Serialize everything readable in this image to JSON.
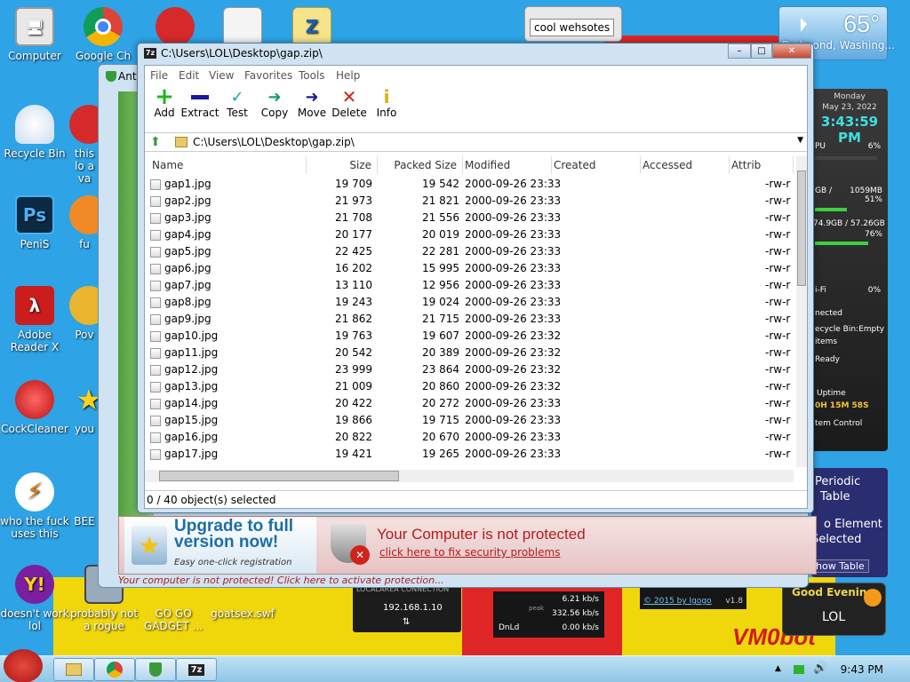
{
  "desktop": {
    "icons": [
      {
        "label": "Computer"
      },
      {
        "label": "Google Ch"
      },
      {
        "label": "Recycle Bin"
      },
      {
        "label": "this lo a va"
      },
      {
        "label": "PeniS"
      },
      {
        "label": "fu"
      },
      {
        "label": "Adobe Reader X"
      },
      {
        "label": "Pov"
      },
      {
        "label": "CockCleaner"
      },
      {
        "label": "you"
      },
      {
        "label": "who the fuck uses this"
      },
      {
        "label": "BEE"
      },
      {
        "label": "doesn't work lol"
      },
      {
        "label": "probably not a rogue"
      },
      {
        "label": "GO GO GADGET ..."
      },
      {
        "label": "goatsex.swf"
      }
    ],
    "icon_letters": {
      "photoshop": "Ps",
      "note": "Z"
    },
    "search_gadget_text": "cool wehsotes",
    "weather": {
      "temp": "65°",
      "location": "Redmond, Washing..."
    },
    "sysmon": {
      "day": "Monday",
      "date": "May 23, 2022",
      "time": "3:43:59 PM",
      "cpu_label": "PU",
      "cpu": "6%",
      "ram_left": "GB /",
      "ram_total": "1059MB",
      "ram_pct": "51%",
      "disk": "74.9GB / 57.26GB",
      "disk_pct": "76%",
      "wifi": "i-Fi",
      "wifi_pct": "0%",
      "net": "nected",
      "recycle": "ecycle Bin:Empty",
      "items": "items",
      "ready": "Ready",
      "uptime_label": "Uptime",
      "uptime": "0H 15M 58S",
      "control": "tem Control"
    },
    "periodic": {
      "title1": "Periodic",
      "title2": "Table",
      "line1": "o Element",
      "line2": "Selected",
      "button": "how Table"
    },
    "evening": {
      "greeting": "Good Evening.",
      "name": "LOL"
    },
    "net_gadget": {
      "ip": "192.168.1.10",
      "header": "LOCALAREA CONNECTION"
    },
    "speed_gadget": {
      "up": "6.21 kb/s",
      "peak": "332.56 kb/s",
      "dnld_label": "DnLd",
      "dnld": "0.00 kb/s",
      "peak_label": "peak"
    },
    "copyright": {
      "text": "© 2015 by Igogo",
      "version": "v1.8"
    },
    "wallpaper_text": "VM0bot"
  },
  "antivirus": {
    "title": "Ant",
    "promo_title": "Upgrade to full version now!",
    "promo_sub": "Easy one-click registration",
    "warning": "Your Computer is not protected",
    "warning_link": "click here to fix security problems",
    "bottom": "Your computer is not protected! Click here to activate protection..."
  },
  "zip": {
    "title": "C:\\Users\\LOL\\Desktop\\gap.zip\\",
    "menu": [
      "File",
      "Edit",
      "View",
      "Favorites",
      "Tools",
      "Help"
    ],
    "toolbar": [
      "Add",
      "Extract",
      "Test",
      "Copy",
      "Move",
      "Delete",
      "Info"
    ],
    "address": "C:\\Users\\LOL\\Desktop\\gap.zip\\",
    "columns": [
      "Name",
      "Size",
      "Packed Size",
      "Modified",
      "Created",
      "Accessed",
      "Attrib"
    ],
    "rows": [
      [
        "gap1.jpg",
        "19 709",
        "19 542",
        "2000-09-26 23:33",
        "-rw-r"
      ],
      [
        "gap2.jpg",
        "21 973",
        "21 821",
        "2000-09-26 23:33",
        "-rw-r"
      ],
      [
        "gap3.jpg",
        "21 708",
        "21 556",
        "2000-09-26 23:33",
        "-rw-r"
      ],
      [
        "gap4.jpg",
        "20 177",
        "20 019",
        "2000-09-26 23:33",
        "-rw-r"
      ],
      [
        "gap5.jpg",
        "22 425",
        "22 281",
        "2000-09-26 23:33",
        "-rw-r"
      ],
      [
        "gap6.jpg",
        "16 202",
        "15 995",
        "2000-09-26 23:33",
        "-rw-r"
      ],
      [
        "gap7.jpg",
        "13 110",
        "12 956",
        "2000-09-26 23:33",
        "-rw-r"
      ],
      [
        "gap8.jpg",
        "19 243",
        "19 024",
        "2000-09-26 23:33",
        "-rw-r"
      ],
      [
        "gap9.jpg",
        "21 862",
        "21 715",
        "2000-09-26 23:33",
        "-rw-r"
      ],
      [
        "gap10.jpg",
        "19 763",
        "19 607",
        "2000-09-26 23:32",
        "-rw-r"
      ],
      [
        "gap11.jpg",
        "20 542",
        "20 389",
        "2000-09-26 23:32",
        "-rw-r"
      ],
      [
        "gap12.jpg",
        "23 999",
        "23 864",
        "2000-09-26 23:32",
        "-rw-r"
      ],
      [
        "gap13.jpg",
        "21 009",
        "20 860",
        "2000-09-26 23:32",
        "-rw-r"
      ],
      [
        "gap14.jpg",
        "20 422",
        "20 272",
        "2000-09-26 23:33",
        "-rw-r"
      ],
      [
        "gap15.jpg",
        "19 866",
        "19 715",
        "2000-09-26 23:33",
        "-rw-r"
      ],
      [
        "gap16.jpg",
        "20 822",
        "20 670",
        "2000-09-26 23:33",
        "-rw-r"
      ],
      [
        "gap17.jpg",
        "19 421",
        "19 265",
        "2000-09-26 23:33",
        "-rw-r"
      ]
    ],
    "status": "0 / 40 object(s) selected"
  },
  "taskbar": {
    "clock": "9:43 PM",
    "zip_icon": "7z"
  },
  "colors": {
    "desktop": "#2ea3e6",
    "warning_red": "#b51c1c",
    "promo_blue": "#1b6ea8",
    "sys_green": "#3fd13f"
  }
}
